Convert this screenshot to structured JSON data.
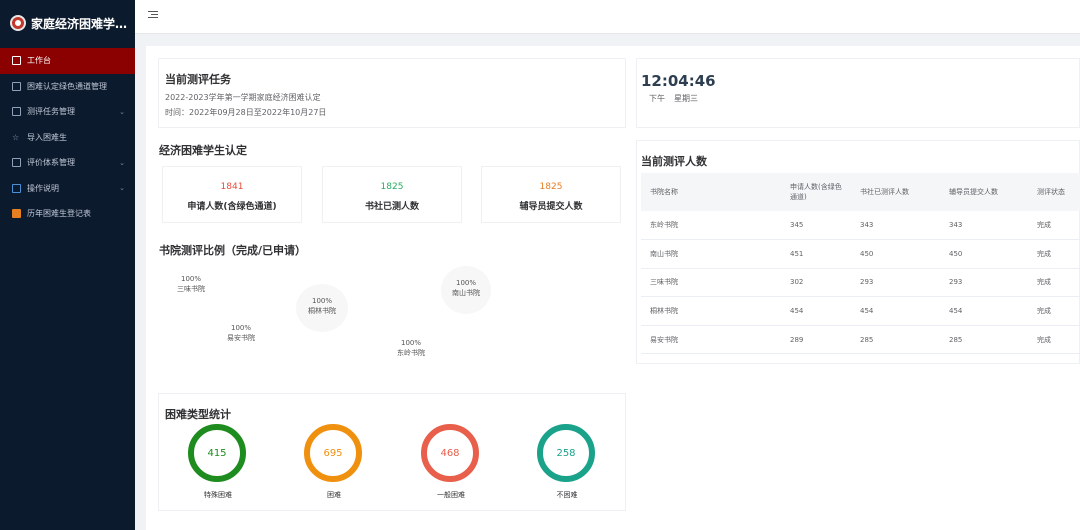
{
  "sidebar": {
    "brand_title": "家庭经济困难学生认定",
    "items": [
      {
        "label": "工作台",
        "active": true,
        "has_children": false
      },
      {
        "label": "困难认定绿色通道管理",
        "active": false,
        "has_children": false
      },
      {
        "label": "测评任务管理",
        "active": false,
        "has_children": true
      },
      {
        "label": "导入困难生",
        "active": false,
        "has_children": false
      },
      {
        "label": "评价体系管理",
        "active": false,
        "has_children": true
      },
      {
        "label": "操作说明",
        "active": false,
        "has_children": true
      },
      {
        "label": "历年困难生登记表",
        "active": false,
        "has_children": false
      }
    ]
  },
  "task": {
    "title": "当前测评任务",
    "name": "2022-2023学年第一学期家庭经济困难认定",
    "time": "时间：2022年09月28日至2022年10月27日"
  },
  "clock": {
    "time": "12:04:46",
    "ampm": "下午",
    "weekday": "星期三"
  },
  "identify": {
    "title": "经济困难学生认定",
    "stats": [
      {
        "value": "1841",
        "label": "申请人数(含绿色通道)",
        "color": "#e74c3c"
      },
      {
        "value": "1825",
        "label": "书社已测人数",
        "color": "#27ae60"
      },
      {
        "value": "1825",
        "label": "辅导员提交人数",
        "color": "#e67e22"
      }
    ]
  },
  "ratio": {
    "title": "书院测评比例（完成/已申请）",
    "bubbles": [
      {
        "pct": "100%",
        "name": "三味书院"
      },
      {
        "pct": "100%",
        "name": "南山书院"
      },
      {
        "pct": "100%",
        "name": "桐林书院"
      },
      {
        "pct": "100%",
        "name": "易安书院"
      },
      {
        "pct": "100%",
        "name": "东岭书院"
      }
    ]
  },
  "count": {
    "title": "当前测评人数",
    "headers": [
      "书院名称",
      "申请人数(含绿色通道)",
      "书社已测评人数",
      "辅导员提交人数",
      "测评状态"
    ],
    "rows": [
      [
        "东岭书院",
        "345",
        "343",
        "343",
        "完成"
      ],
      [
        "南山书院",
        "451",
        "450",
        "450",
        "完成"
      ],
      [
        "三味书院",
        "302",
        "293",
        "293",
        "完成"
      ],
      [
        "桐林书院",
        "454",
        "454",
        "454",
        "完成"
      ],
      [
        "易安书院",
        "289",
        "285",
        "285",
        "完成"
      ]
    ]
  },
  "types": {
    "title": "困难类型统计",
    "items": [
      {
        "value": "415",
        "label": "特殊困难",
        "color": "#1e8c1e"
      },
      {
        "value": "695",
        "label": "困难",
        "color": "#f0900f"
      },
      {
        "value": "468",
        "label": "一般困难",
        "color": "#e8604c"
      },
      {
        "value": "258",
        "label": "不困难",
        "color": "#1aa38a"
      }
    ]
  }
}
